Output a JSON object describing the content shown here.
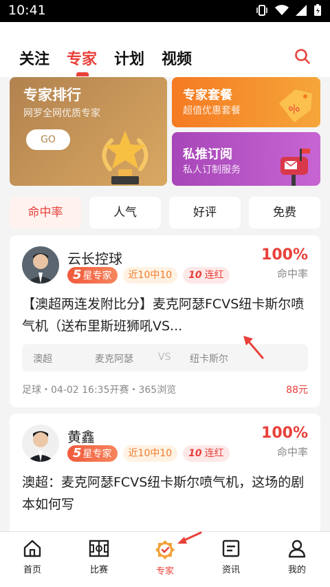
{
  "status_bar": {
    "time": "10:41"
  },
  "top_tabs": [
    {
      "label": "关注"
    },
    {
      "label": "专家",
      "active": true
    },
    {
      "label": "计划"
    },
    {
      "label": "视频"
    }
  ],
  "banners": {
    "rank": {
      "title": "专家排行",
      "subtitle": "网罗全网优质专家",
      "button": "GO"
    },
    "package": {
      "title": "专家套餐",
      "subtitle": "超值优惠套餐"
    },
    "private": {
      "title": "私推订阅",
      "subtitle": "私人订制服务"
    }
  },
  "filters": [
    {
      "label": "命中率",
      "active": true
    },
    {
      "label": "人气"
    },
    {
      "label": "好评"
    },
    {
      "label": "免费"
    }
  ],
  "cards": [
    {
      "name": "云长控球",
      "star_level": "5",
      "star_suffix": "星专家",
      "recent": "近10中10",
      "streak_num": "10",
      "streak_suffix": "连红",
      "hit_rate": "100%",
      "hit_label": "命中率",
      "headline": "【澳超两连发附比分】麦克阿瑟FCVS纽卡斯尔喷气机（送布里斯班狮吼VS...",
      "league": "澳超",
      "home": "麦克阿瑟",
      "vs": "VS",
      "away": "纽卡斯尔",
      "meta": "足球・04-02 16:35开赛・365浏览",
      "price": "88元"
    },
    {
      "name": "黄鑫",
      "star_level": "5",
      "star_suffix": "星专家",
      "recent": "近10中10",
      "streak_num": "10",
      "streak_suffix": "连红",
      "hit_rate": "100%",
      "hit_label": "命中率",
      "headline": "澳超：麦克阿瑟FCVS纽卡斯尔喷气机，这场的剧本如何写"
    }
  ],
  "bottom_nav": [
    {
      "label": "首页"
    },
    {
      "label": "比赛"
    },
    {
      "label": "专家",
      "active": true
    },
    {
      "label": "资讯"
    },
    {
      "label": "我的"
    }
  ],
  "colors": {
    "accent": "#e8413a",
    "gold": "#b2824f",
    "orange": "#f57a22",
    "purple": "#a746b8"
  }
}
